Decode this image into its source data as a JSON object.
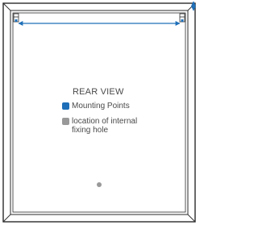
{
  "view_title": "REAR VIEW",
  "legend": {
    "mounting_points": {
      "label": "Mounting Points",
      "color": "#1e6fb8"
    },
    "fixing_hole": {
      "label_line1": "location of internal",
      "label_line2": "fixing hole",
      "color": "#999999"
    }
  },
  "colors": {
    "frame_stroke": "#2b2b2b",
    "dimension_arrow": "#1e6fb8",
    "text": "#4a4a4a"
  },
  "icons": {
    "width_dimension": "double-headed-horizontal-arrow",
    "corner_bracket": "hanging-bracket-icon",
    "depth_dimension": "double-headed-vertical-arrow"
  }
}
